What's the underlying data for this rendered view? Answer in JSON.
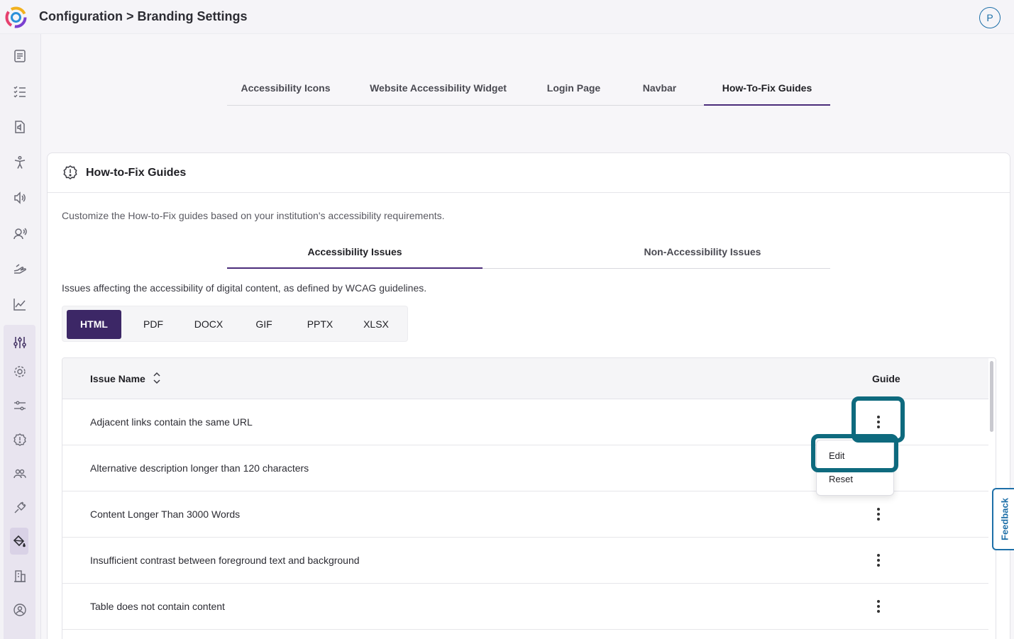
{
  "header": {
    "breadcrumb": "Configuration > Branding Settings",
    "avatar_initial": "P"
  },
  "sidebar": {
    "items": [
      {
        "icon": "document-icon"
      },
      {
        "icon": "checklist-icon"
      },
      {
        "icon": "audio-file-icon"
      },
      {
        "icon": "accessibility-person-icon"
      },
      {
        "icon": "speaker-icon"
      },
      {
        "icon": "voice-user-icon"
      },
      {
        "icon": "hand-icon"
      },
      {
        "icon": "line-chart-icon"
      },
      {
        "icon": "sliders-icon"
      },
      {
        "icon": "gear-icon"
      },
      {
        "icon": "filter-sliders-icon"
      },
      {
        "icon": "guide-badge-icon"
      },
      {
        "icon": "users-icon"
      },
      {
        "icon": "plug-icon"
      },
      {
        "icon": "paint-bucket-icon"
      },
      {
        "icon": "building-icon"
      },
      {
        "icon": "user-settings-icon"
      }
    ],
    "active_icon": "paint-bucket-icon"
  },
  "top_tabs": [
    {
      "label": "Accessibility Icons"
    },
    {
      "label": "Website Accessibility Widget"
    },
    {
      "label": "Login Page"
    },
    {
      "label": "Navbar"
    },
    {
      "label": "How-To-Fix Guides"
    }
  ],
  "card": {
    "title": "How-to-Fix Guides",
    "description": "Customize the How-to-Fix guides based on your institution's accessibility requirements.",
    "sub_tabs": [
      {
        "label": "Accessibility Issues"
      },
      {
        "label": "Non-Accessibility Issues"
      }
    ],
    "issues_description": "Issues affecting the accessibility of digital content, as defined by WCAG guidelines.",
    "formats": [
      {
        "label": "HTML"
      },
      {
        "label": "PDF"
      },
      {
        "label": "DOCX"
      },
      {
        "label": "GIF"
      },
      {
        "label": "PPTX"
      },
      {
        "label": "XLSX"
      }
    ],
    "active_format": "HTML"
  },
  "table": {
    "columns": {
      "name": "Issue Name",
      "guide": "Guide"
    },
    "rows": [
      {
        "name": "Adjacent links contain the same URL"
      },
      {
        "name": "Alternative description longer than 120 characters"
      },
      {
        "name": "Content Longer Than 3000 Words"
      },
      {
        "name": "Insufficient contrast between foreground text and background"
      },
      {
        "name": "Table does not contain content"
      }
    ]
  },
  "menu": {
    "edit_label": "Edit",
    "reset_label": "Reset"
  },
  "feedback": {
    "label": "Feedback"
  },
  "colors": {
    "accent": "#3c2766",
    "highlight": "#0e6a7e",
    "link": "#1d6fa8"
  }
}
